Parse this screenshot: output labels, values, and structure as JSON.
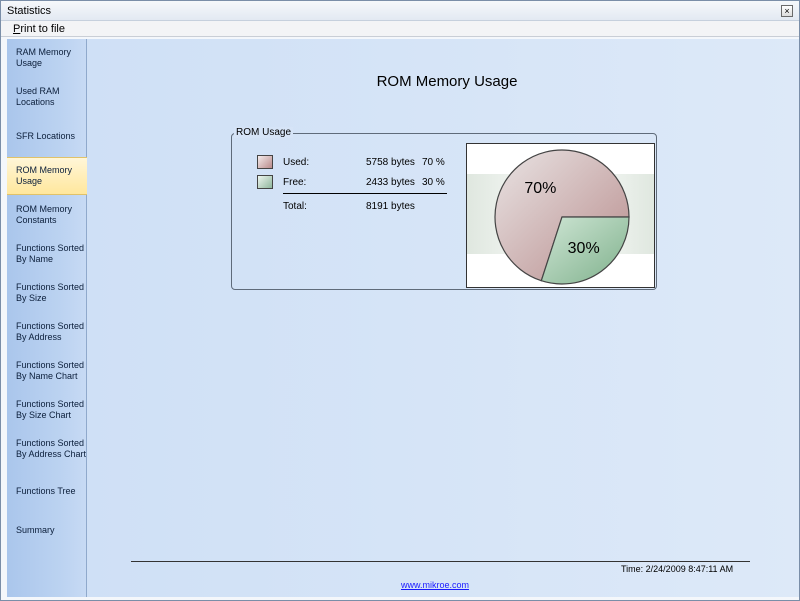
{
  "window": {
    "title": "Statistics",
    "close_glyph": "×"
  },
  "menu": {
    "print_prefix": "P",
    "print_rest": "rint to file"
  },
  "sidebar": {
    "items": [
      {
        "label": "RAM Memory\nUsage",
        "active": false
      },
      {
        "label": "Used RAM\nLocations",
        "active": false
      },
      {
        "label": "SFR Locations",
        "active": false
      },
      {
        "label": "ROM Memory\nUsage",
        "active": true
      },
      {
        "label": "ROM Memory\nConstants",
        "active": false
      },
      {
        "label": "Functions Sorted\nBy  Name",
        "active": false
      },
      {
        "label": "Functions Sorted\nBy Size",
        "active": false
      },
      {
        "label": "Functions Sorted\nBy Address",
        "active": false
      },
      {
        "label": "Functions Sorted\nBy Name Chart",
        "active": false
      },
      {
        "label": "Functions Sorted\nBy Size Chart",
        "active": false
      },
      {
        "label": "Functions Sorted\nBy Address Chart",
        "active": false
      },
      {
        "label": "Functions Tree",
        "active": false
      },
      {
        "label": "Summary",
        "active": false
      }
    ]
  },
  "main": {
    "title": "ROM Memory  Usage",
    "group_title": "ROM Usage",
    "rows": {
      "used": {
        "label": "Used:",
        "bytes": "5758 bytes",
        "percent": "70 %"
      },
      "free": {
        "label": "Free:",
        "bytes": "2433 bytes",
        "percent": "30 %"
      },
      "total": {
        "label": "Total:",
        "bytes": "8191 bytes"
      }
    }
  },
  "chart_data": {
    "type": "pie",
    "slices": [
      {
        "value": 70,
        "label": "70%",
        "color": "#c4a3a3"
      },
      {
        "value": 30,
        "label": "30%",
        "color": "#8fbb9a"
      }
    ]
  },
  "footer": {
    "time": "Time: 2/24/2009 8:47:11 AM",
    "link": "www.mikroe.com"
  }
}
